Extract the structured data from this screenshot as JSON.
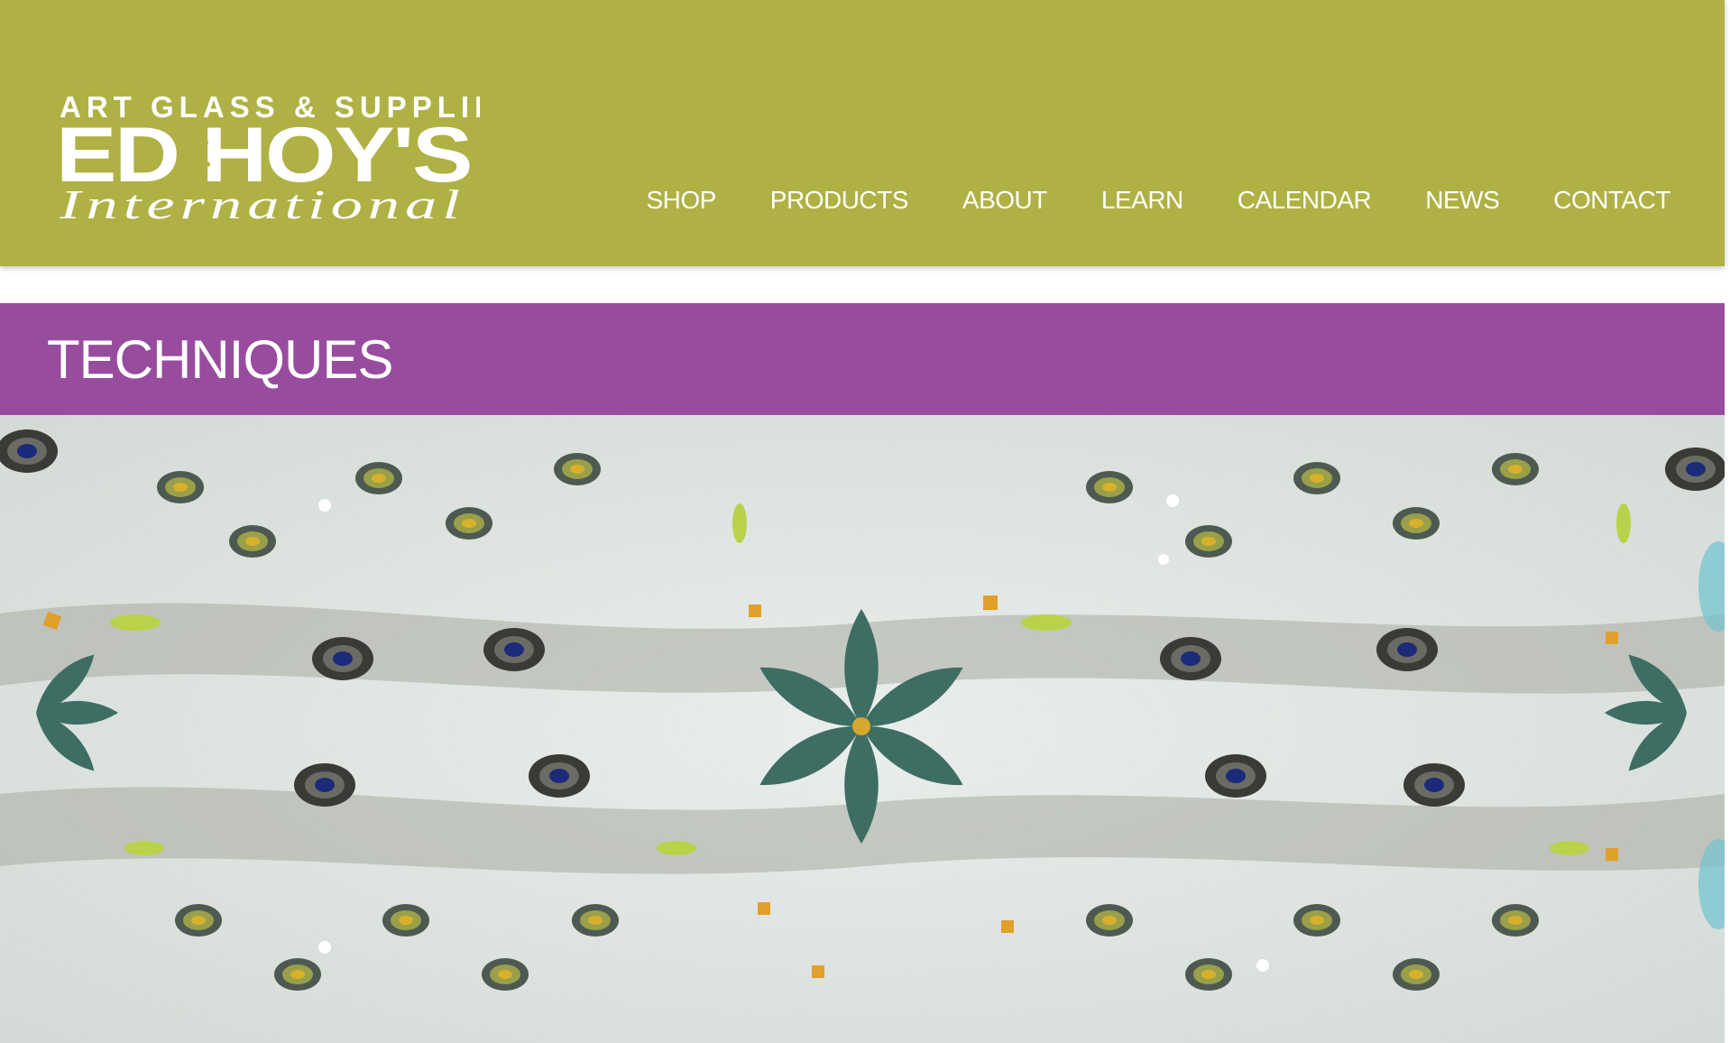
{
  "brand": {
    "tagline": "ART GLASS & SUPPLIES",
    "name": "ED HOY'S",
    "sub": "International",
    "colors": {
      "header": "#b0b145",
      "banner": "#984c9e"
    }
  },
  "nav": {
    "items": [
      "SHOP",
      "PRODUCTS",
      "ABOUT",
      "LEARN",
      "CALENDAR",
      "NEWS",
      "CONTACT"
    ]
  },
  "page": {
    "title": "TECHNIQUES"
  },
  "hero": {
    "image": "kaleidoscope-fused-glass-pattern"
  }
}
